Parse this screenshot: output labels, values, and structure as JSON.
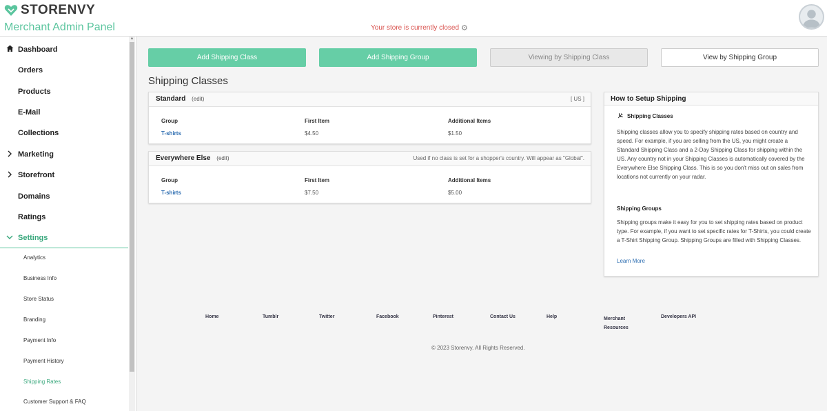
{
  "header": {
    "brand": "STORENVY",
    "panel_title": "Merchant Admin Panel",
    "store_status": "Your store is currently closed"
  },
  "sidebar": {
    "items": [
      {
        "label": "Dashboard",
        "icon": "home-icon"
      },
      {
        "label": "Orders"
      },
      {
        "label": "Products"
      },
      {
        "label": "E-Mail"
      },
      {
        "label": "Collections"
      },
      {
        "label": "Marketing",
        "icon": "chevron-right-icon"
      },
      {
        "label": "Storefront",
        "icon": "chevron-right-icon"
      },
      {
        "label": "Domains"
      },
      {
        "label": "Ratings"
      },
      {
        "label": "Settings",
        "icon": "chevron-down-icon"
      }
    ],
    "sub_items": [
      {
        "label": "Analytics"
      },
      {
        "label": "Business Info"
      },
      {
        "label": "Store Status"
      },
      {
        "label": "Branding"
      },
      {
        "label": "Payment Info"
      },
      {
        "label": "Payment History"
      },
      {
        "label": "Shipping Rates"
      },
      {
        "label": "Customer Support & FAQ"
      }
    ]
  },
  "toolbar": {
    "add_class": "Add Shipping Class",
    "add_group": "Add Shipping Group",
    "viewing_by_class": "Viewing by Shipping Class",
    "view_by_group": "View by Shipping Group"
  },
  "main": {
    "section_title": "Shipping Classes",
    "columns": [
      "Group",
      "First Item",
      "Additional Items"
    ],
    "classes": [
      {
        "name": "Standard",
        "edit": "(edit)",
        "note": "[ US ]",
        "rows": [
          {
            "group": "T-shirts",
            "first": "$4.50",
            "additional": "$1.50"
          }
        ]
      },
      {
        "name": "Everywhere Else",
        "edit": "(edit)",
        "note": "Used if no class is set for a shopper's country. Will appear as \"Global\".",
        "rows": [
          {
            "group": "T-shirts",
            "first": "$7.50",
            "additional": "$5.00"
          }
        ]
      }
    ]
  },
  "help": {
    "title": "How to Setup Shipping",
    "classes_heading": "Shipping Classes",
    "classes_text": "Shipping classes allow you to specify shipping rates based on country and speed. For example, if you are selling from the US, you might create a Standard Shipping Class and a 2-Day Shipping Class for shipping within the US. Any country not in your Shipping Classes is automatically covered by the Everywhere Else Shipping Class. This is so you don't miss out on sales from locations not currently on your radar.",
    "groups_heading": "Shipping Groups",
    "groups_text": "Shipping groups make it easy for you to set shipping rates based on product type. For example, if you want to set specific rates for T-Shirts, you could create a T-Shirt Shipping Group. Shipping Groups are filled with Shipping Classes.",
    "learn_more": "Learn More"
  },
  "footer": {
    "links": [
      "Home",
      "Tumblr",
      "Twitter",
      "Facebook",
      "Pinterest",
      "Contact Us",
      "Help",
      "Merchant Resources",
      "Developers API"
    ],
    "copyright": "© 2023 Storenvy. All Rights Reserved."
  },
  "colors": {
    "accent": "#5bc59e",
    "button_green": "#66cea6",
    "link": "#2b6cb0",
    "alert": "#d9534f"
  }
}
